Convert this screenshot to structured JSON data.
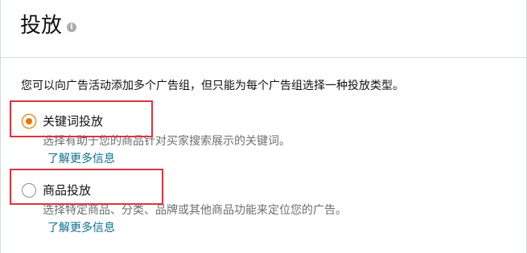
{
  "header": {
    "title": "投放",
    "info_icon_glyph": "i"
  },
  "intro_text": "您可以向广告活动添加多个广告组，但只能为每个广告组选择一种投放类型。",
  "options": [
    {
      "label": "关键词投放",
      "description": "选择有助于您的商品针对买家搜索展示的关键词。",
      "learn_more": "了解更多信息",
      "selected": true
    },
    {
      "label": "商品投放",
      "description": "选择特定商品、分类、品牌或其他商品功能来定位您的广告。",
      "learn_more": "了解更多信息",
      "selected": false
    }
  ],
  "colors": {
    "accent": "#e77600",
    "highlight": "#d9363e",
    "link": "#0a6f8f"
  }
}
